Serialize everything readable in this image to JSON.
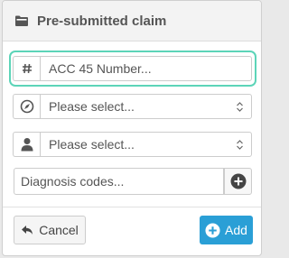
{
  "modal": {
    "title": "Pre-submitted claim",
    "title_icon": "folder-icon"
  },
  "form": {
    "acc_number": {
      "icon": "hash-icon",
      "placeholder": "ACC 45 Number...",
      "value": ""
    },
    "provider_select": {
      "icon": "compass-icon",
      "selected": "Please select..."
    },
    "person_select": {
      "icon": "user-icon",
      "selected": "Please select..."
    },
    "diagnosis": {
      "placeholder": "Diagnosis codes...",
      "add_icon": "plus-circle-icon"
    }
  },
  "footer": {
    "cancel_label": "Cancel",
    "cancel_icon": "reply-icon",
    "add_label": "Add",
    "add_icon": "plus-circle-icon"
  },
  "colors": {
    "focus_ring": "#5cd4b8",
    "primary": "#2a9fd6",
    "header_bg": "#f3f3f3"
  }
}
